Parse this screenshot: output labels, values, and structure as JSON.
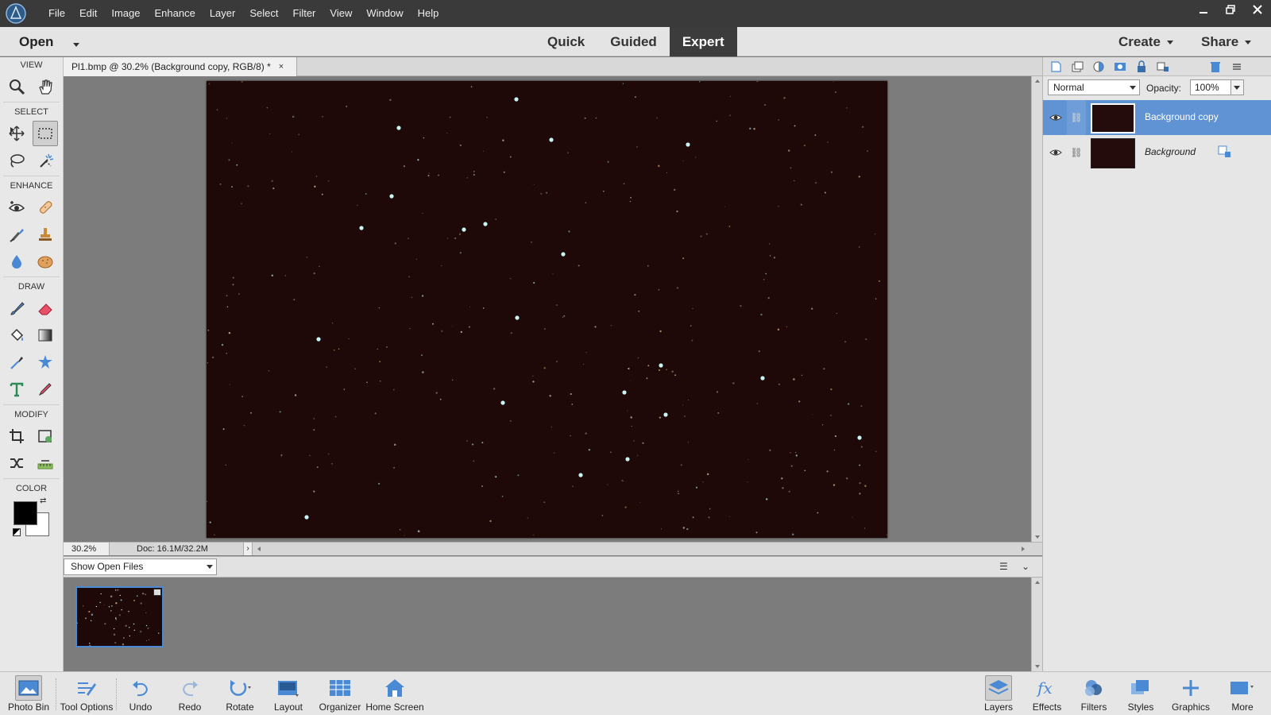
{
  "menubar": {
    "items": [
      "File",
      "Edit",
      "Image",
      "Enhance",
      "Layer",
      "Select",
      "Filter",
      "View",
      "Window",
      "Help"
    ]
  },
  "modebar": {
    "open_label": "Open",
    "tabs": [
      "Quick",
      "Guided",
      "Expert"
    ],
    "active_tab": "Expert",
    "create_label": "Create",
    "share_label": "Share"
  },
  "tools": {
    "sections": [
      "VIEW",
      "SELECT",
      "ENHANCE",
      "DRAW",
      "MODIFY",
      "COLOR"
    ],
    "foreground_color": "#000000",
    "background_color": "#ffffff"
  },
  "document": {
    "tab_title": "Pl1.bmp @ 30.2% (Background copy, RGB/8) *",
    "zoom": "30.2%",
    "doc_size": "Doc: 16.1M/32.2M"
  },
  "photo_bin": {
    "select_value": "Show Open Files"
  },
  "layers": {
    "blend_mode": "Normal",
    "opacity_label": "Opacity:",
    "opacity_value": "100%",
    "items": [
      {
        "name": "Background copy",
        "selected": true
      },
      {
        "name": "Background",
        "selected": false
      }
    ]
  },
  "taskbar": {
    "left": [
      "Photo Bin",
      "Tool Options",
      "Undo",
      "Redo",
      "Rotate",
      "Layout",
      "Organizer",
      "Home Screen"
    ],
    "right": [
      "Layers",
      "Effects",
      "Filters",
      "Styles",
      "Graphics",
      "More"
    ]
  },
  "colors": {
    "accent": "#5f93d4",
    "canvas_bg": "#1e0808",
    "menubar_bg": "#3a3a3a"
  }
}
